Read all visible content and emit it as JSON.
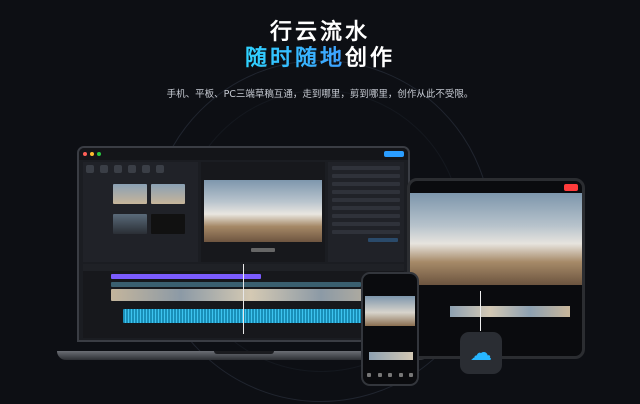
{
  "headline": {
    "line1": "行云流水",
    "line2_highlight": "随时随地",
    "line2_rest": "创作"
  },
  "subtitle": "手机、平板、PC三端草稿互通，走到哪里，剪到哪里，创作从此不受限。",
  "colors": {
    "accent": "#2fd3ff",
    "accent2": "#3ea0ff",
    "export_red": "#ff3b3b",
    "track_blue": "#3ec4f0",
    "track_purple": "#7b5cff"
  },
  "icons": {
    "cloud": "cloud-sync-icon"
  }
}
